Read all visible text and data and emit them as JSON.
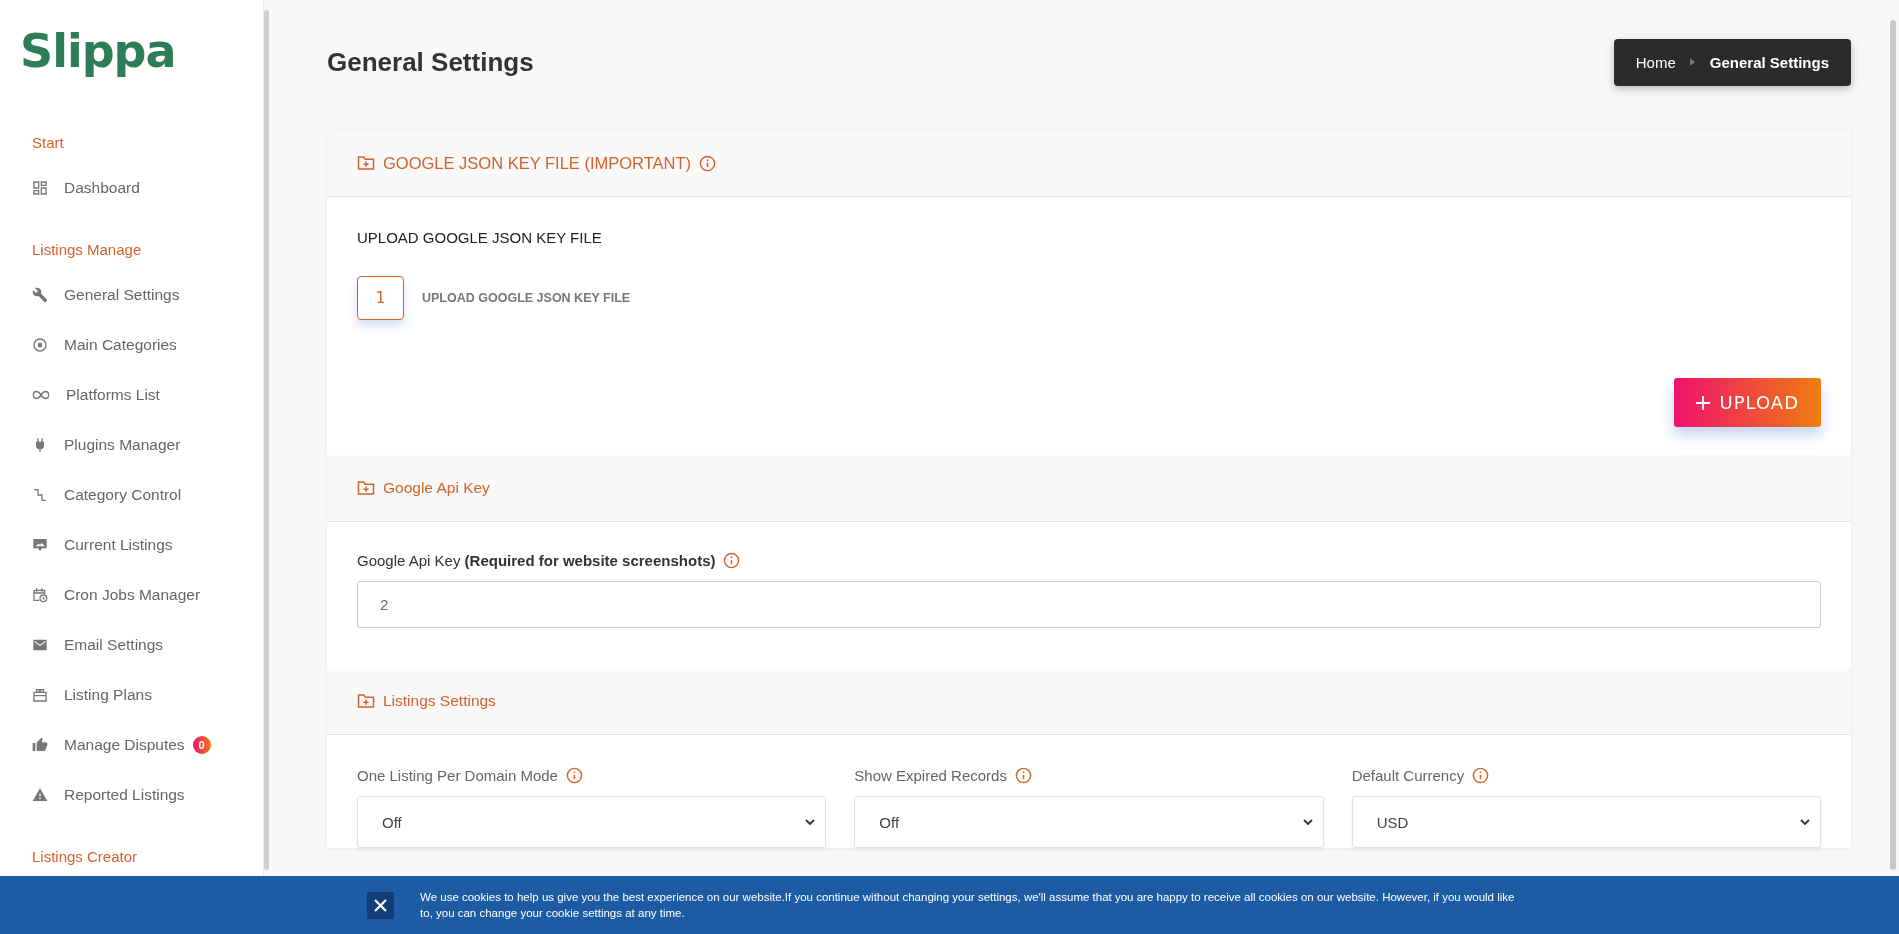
{
  "logo": "Slippa",
  "sidebar": {
    "groups": [
      {
        "title": "Start",
        "items": [
          {
            "label": "Dashboard",
            "kind": "dashboard"
          }
        ]
      },
      {
        "title": "Listings Manage",
        "items": [
          {
            "label": "General Settings",
            "kind": "wrench"
          },
          {
            "label": "Main Categories",
            "kind": "target"
          },
          {
            "label": "Platforms List",
            "kind": "infinity"
          },
          {
            "label": "Plugins Manager",
            "kind": "plug"
          },
          {
            "label": "Category Control",
            "kind": "steps"
          },
          {
            "label": "Current Listings",
            "kind": "monitor"
          },
          {
            "label": "Cron Jobs Manager",
            "kind": "calendar"
          },
          {
            "label": "Email Settings",
            "kind": "mail"
          },
          {
            "label": "Listing Plans",
            "kind": "gift"
          },
          {
            "label": "Manage Disputes",
            "kind": "thumb",
            "badge": "0"
          },
          {
            "label": "Reported Listings",
            "kind": "warning"
          }
        ]
      },
      {
        "title": "Listings Creator"
      }
    ]
  },
  "page_title": "General Settings",
  "breadcrumb": [
    "Home",
    "General Settings"
  ],
  "sections": [
    {
      "title": "GOOGLE JSON KEY FILE (IMPORTANT)",
      "info": true,
      "kind": "upload",
      "heading": "UPLOAD GOOGLE JSON KEY FILE",
      "step": "1",
      "step_label": "UPLOAD GOOGLE JSON KEY FILE",
      "button": "UPLOAD"
    },
    {
      "title": "Google Api Key",
      "info": false,
      "kind": "text",
      "fields": [
        {
          "label": "Google Api Key **(Required for website screenshots)**",
          "info": true,
          "value": "2"
        }
      ]
    },
    {
      "title": "Listings Settings",
      "info": false,
      "kind": "selects",
      "fields": [
        {
          "label": "One Listing Per Domain Mode",
          "info": true,
          "value": "Off"
        },
        {
          "label": "Show Expired Records",
          "info": true,
          "value": "Off"
        },
        {
          "label": "Default Currency",
          "info": true,
          "value": "USD"
        }
      ]
    }
  ],
  "cookie_banner": {
    "text": "We use cookies to help us give you the best experience on our website.If you continue without changing your settings, we'll assume that you are happy to receive all cookies on our website. However, if you would like to, you can change your cookie settings at any time."
  }
}
